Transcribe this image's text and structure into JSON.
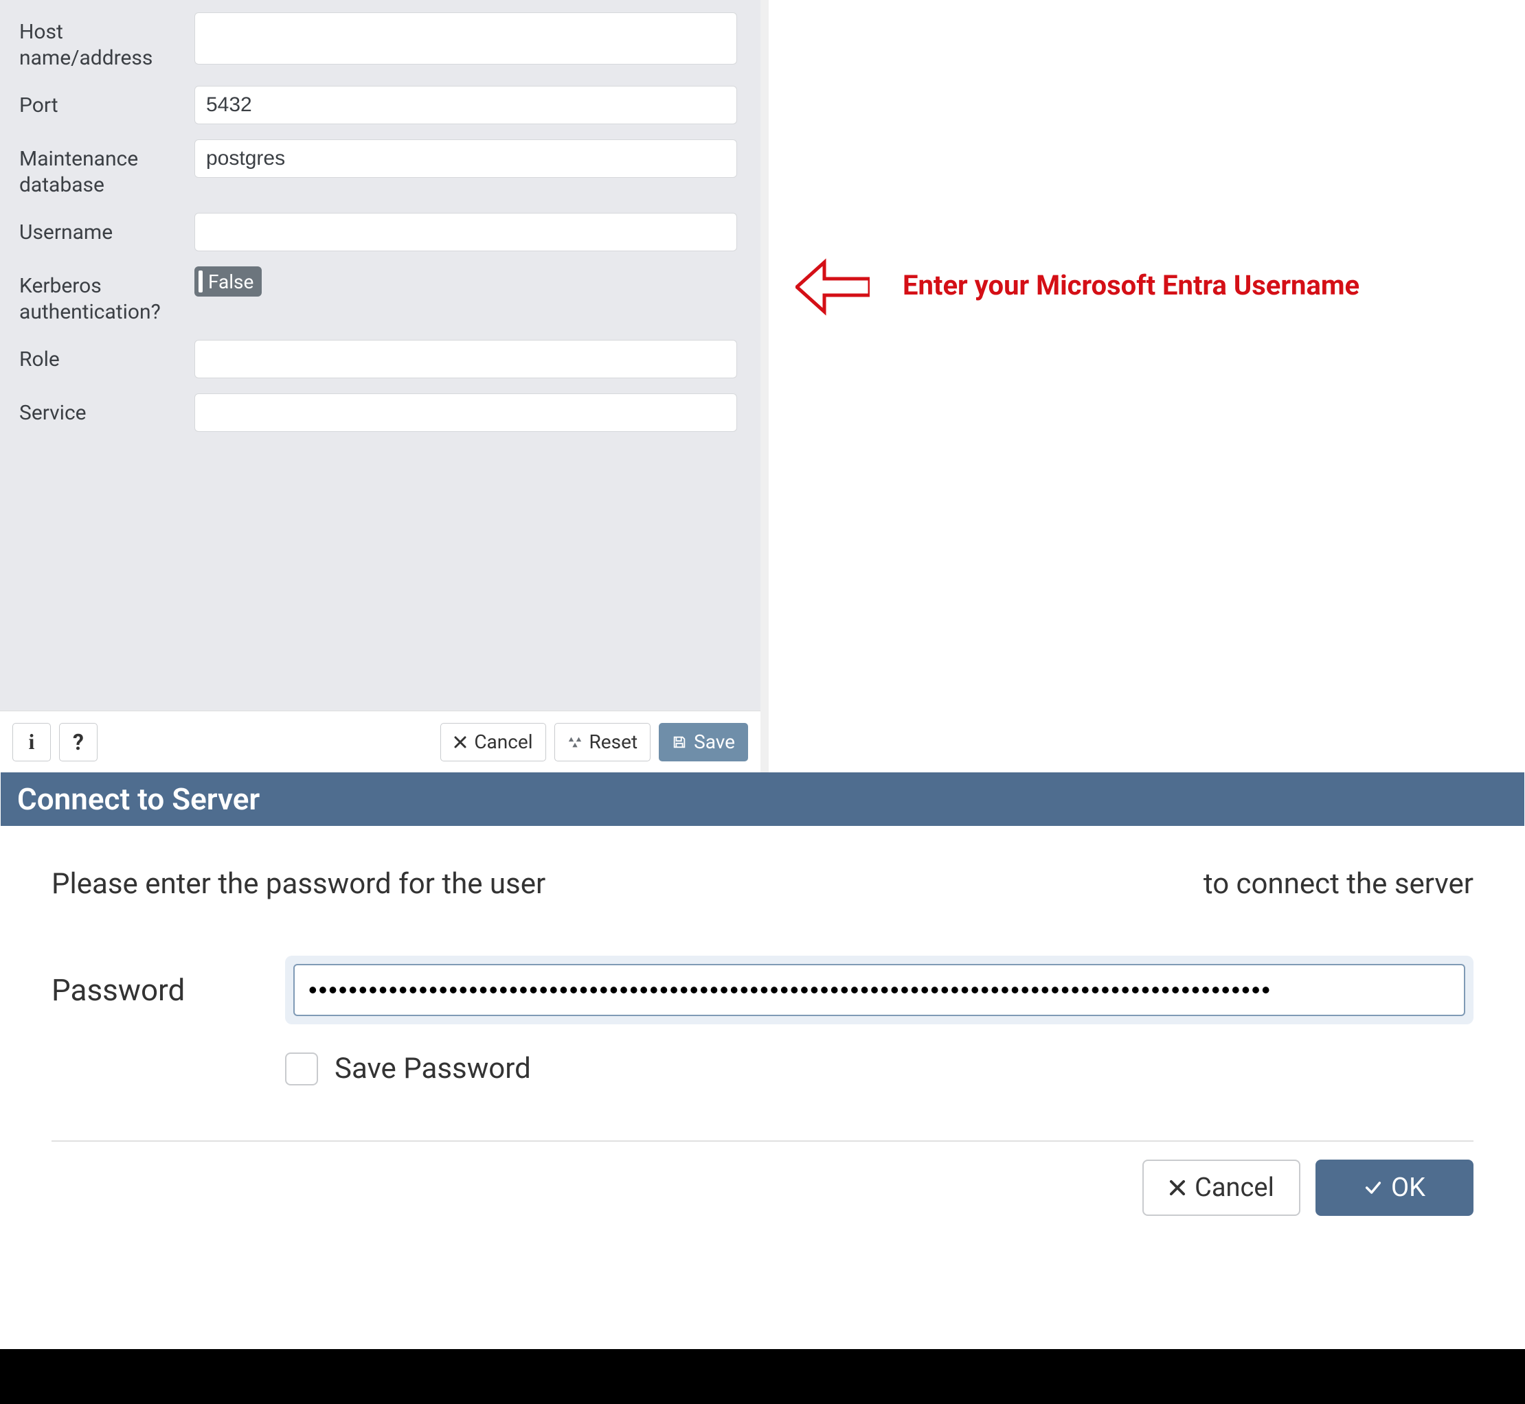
{
  "form": {
    "hostLabel": "Host name/address",
    "hostValue": "",
    "portLabel": "Port",
    "portValue": "5432",
    "maintDbLabel": "Maintenance database",
    "maintDbValue": "postgres",
    "usernameLabel": "Username",
    "usernameValue": "",
    "kerberosLabel": "Kerberos authentication?",
    "kerberosValue": "False",
    "roleLabel": "Role",
    "roleValue": "",
    "serviceLabel": "Service",
    "serviceValue": ""
  },
  "toolbar": {
    "infoGlyph": "i",
    "helpGlyph": "?",
    "cancelLabel": "Cancel",
    "resetLabel": "Reset",
    "saveLabel": "Save"
  },
  "annotation": {
    "text": "Enter your Microsoft Entra Username",
    "color": "#d40f16"
  },
  "dialog": {
    "title": "Connect to Server",
    "promptPrefix": "Please enter the password for the user",
    "promptSuffix": "to connect the server",
    "passwordLabel": "Password",
    "passwordValue": "••••••••••••••••••••••••••••••••••••••••••••••••••••••••••••••••••••••••••••••••••••••••••••••••",
    "savePasswordLabel": "Save Password",
    "savePasswordChecked": false,
    "cancelLabel": "Cancel",
    "okLabel": "OK"
  }
}
